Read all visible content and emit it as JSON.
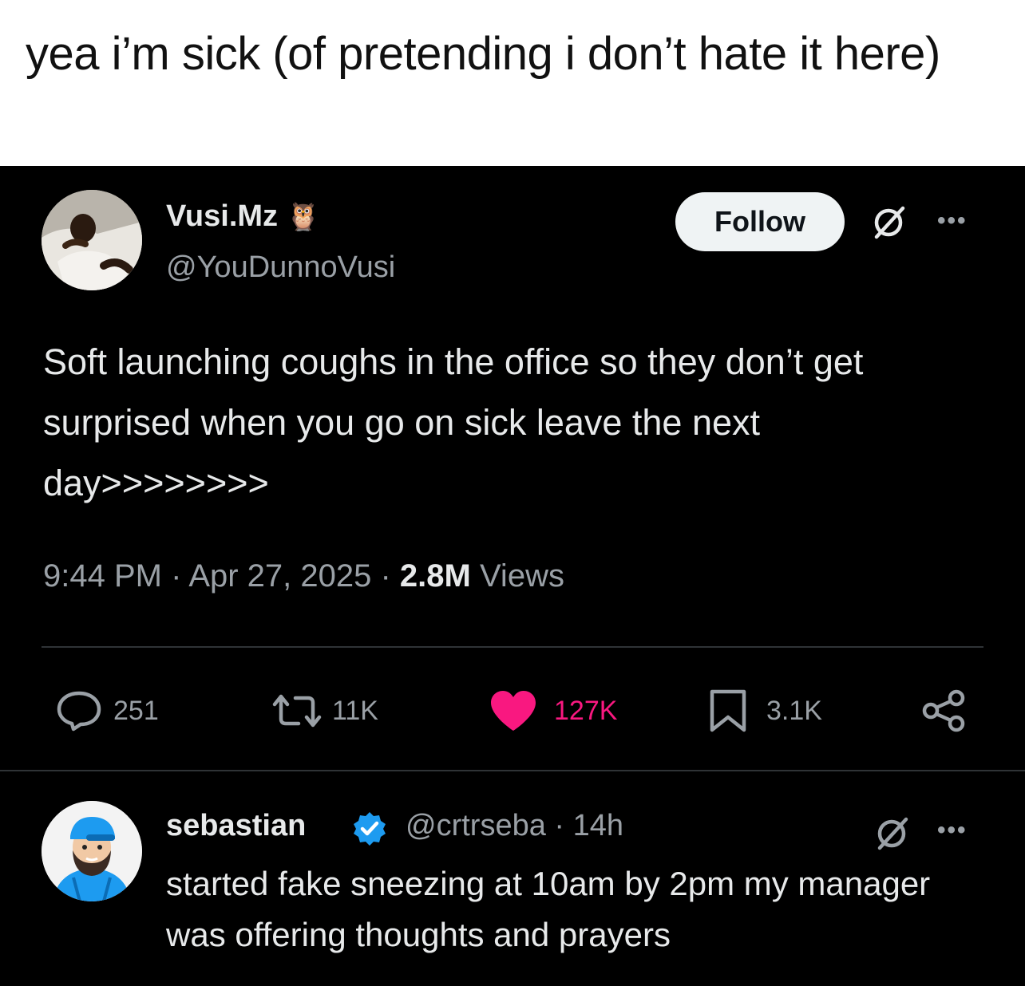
{
  "caption": "yea i’m sick (of pretending i don’t hate it here)",
  "tweet": {
    "display_name": "Vusi.Mz",
    "name_emoji": "🦉",
    "handle": "@YouDunnoVusi",
    "follow_label": "Follow",
    "text": "Soft launching coughs in the office so they don’t get surprised when you go on sick leave the next day>>>>>>>>",
    "time": "9:44 PM",
    "sep1": " · ",
    "date": "Apr 27, 2025",
    "sep2": " · ",
    "views_count": "2.8M",
    "views_label": " Views",
    "actions": {
      "replies": "251",
      "reposts": "11K",
      "likes": "127K",
      "bookmarks": "3.1K"
    },
    "colors": {
      "like": "#f91880",
      "verified": "#1d9bf0"
    }
  },
  "reply": {
    "display_name": "sebastian",
    "handle": "@crtrseba",
    "sep": " · ",
    "age": "14h",
    "text": "started fake sneezing at 10am by 2pm my manager was offering thoughts and prayers"
  }
}
